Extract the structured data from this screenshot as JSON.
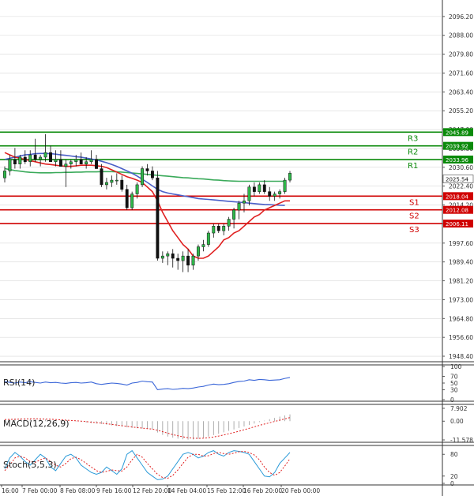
{
  "chart_data": {
    "type": "candlestick",
    "instrument_axis": {
      "ylim": [
        1946,
        2102
      ],
      "ticks": [
        "2096.20",
        "2088.00",
        "2079.80",
        "2071.60",
        "2063.40",
        "2055.20",
        "2047.00",
        "2038.80",
        "2030.60",
        "2022.40",
        "2014.20",
        "2006.00",
        "1997.60",
        "1989.40",
        "1981.20",
        "1973.00",
        "1964.80",
        "1956.60",
        "1948.40"
      ],
      "grid": true
    },
    "x_ticks": [
      "16:00",
      "7 Feb 00:00",
      "8 Feb 08:00",
      "9 Feb 16:00",
      "12 Feb 20:00",
      "14 Feb 04:00",
      "15 Feb 12:00",
      "16 Feb 20:00",
      "20 Feb 00:00"
    ],
    "last_price": "2025.54",
    "levels": [
      {
        "name": "R3",
        "value": 2039.92,
        "label": "2039.92",
        "color": "#0a8a0a"
      },
      {
        "name": "R2",
        "value": 2033.96,
        "label": "2033.96",
        "color": "#0a8a0a"
      },
      {
        "name": "R1",
        "value": 2045.89,
        "label": "2045.89",
        "color": "#0a8a0a"
      },
      {
        "name": "S1",
        "value": 2018.04,
        "label": "2018.04",
        "color": "#d00000"
      },
      {
        "name": "S2",
        "value": 2012.08,
        "label": "2012.08",
        "color": "#d00000"
      },
      {
        "name": "S3",
        "value": 2006.11,
        "label": "2006.11",
        "color": "#d00000"
      }
    ],
    "candles": [
      [
        2026,
        2031,
        2024,
        2029
      ],
      [
        2029,
        2036,
        2027,
        2034
      ],
      [
        2034,
        2039,
        2030,
        2032
      ],
      [
        2032,
        2036,
        2030,
        2035
      ],
      [
        2035,
        2038,
        2032,
        2033
      ],
      [
        2033,
        2038,
        2031,
        2036
      ],
      [
        2036,
        2043,
        2033,
        2034
      ],
      [
        2034,
        2036,
        2031,
        2035
      ],
      [
        2035,
        2045,
        2033,
        2037
      ],
      [
        2037,
        2040,
        2034,
        2033
      ],
      [
        2033,
        2038,
        2031,
        2034
      ],
      [
        2034,
        2038,
        2032,
        2031
      ],
      [
        2031,
        2034,
        2022,
        2032
      ],
      [
        2032,
        2034,
        2030,
        2033
      ],
      [
        2033,
        2036,
        2031,
        2034
      ],
      [
        2034,
        2037,
        2032,
        2032
      ],
      [
        2032,
        2035,
        2030,
        2033
      ],
      [
        2033,
        2038,
        2032,
        2034
      ],
      [
        2034,
        2036,
        2030,
        2030
      ],
      [
        2030,
        2032,
        2022,
        2023
      ],
      [
        2023,
        2026,
        2021,
        2024
      ],
      [
        2024,
        2027,
        2022,
        2025
      ],
      [
        2025,
        2028,
        2023,
        2025
      ],
      [
        2025,
        2027,
        2020,
        2021
      ],
      [
        2021,
        2023,
        2012,
        2013
      ],
      [
        2013,
        2020,
        2012,
        2019
      ],
      [
        2019,
        2024,
        2017,
        2023
      ],
      [
        2023,
        2031,
        2022,
        2030
      ],
      [
        2030,
        2032,
        2027,
        2029
      ],
      [
        2029,
        2031,
        2025,
        2026
      ],
      [
        2026,
        2029,
        1990,
        1991
      ],
      [
        1991,
        1994,
        1989,
        1992
      ],
      [
        1992,
        1994,
        1988,
        1993
      ],
      [
        1993,
        1995,
        1987,
        1991
      ],
      [
        1991,
        1993,
        1986,
        1990
      ],
      [
        1990,
        1994,
        1985,
        1992
      ],
      [
        1992,
        1995,
        1985,
        1988
      ],
      [
        1988,
        1993,
        1986,
        1992
      ],
      [
        1992,
        1997,
        1990,
        1996
      ],
      [
        1996,
        1999,
        1994,
        1997
      ],
      [
        1997,
        2003,
        1996,
        2002
      ],
      [
        2002,
        2006,
        2000,
        2005
      ],
      [
        2005,
        2006,
        2002,
        2003
      ],
      [
        2003,
        2006,
        2001,
        2005
      ],
      [
        2005,
        2009,
        2003,
        2008
      ],
      [
        2008,
        2013,
        2004,
        2012
      ],
      [
        2012,
        2016,
        2008,
        2015
      ],
      [
        2015,
        2019,
        2011,
        2016
      ],
      [
        2016,
        2023,
        2014,
        2022
      ],
      [
        2022,
        2024,
        2018,
        2020
      ],
      [
        2020,
        2024,
        2019,
        2023
      ],
      [
        2023,
        2025,
        2019,
        2020
      ],
      [
        2020,
        2022,
        2016,
        2018
      ],
      [
        2018,
        2020,
        2016,
        2019
      ],
      [
        2019,
        2021,
        2017,
        2020
      ],
      [
        2020,
        2026,
        2019,
        2025
      ],
      [
        2025,
        2029,
        2024,
        2028
      ]
    ],
    "ma_red": [
      2037,
      2036,
      2035,
      2034.5,
      2034,
      2033.5,
      2033,
      2032.5,
      2032,
      2031.8,
      2031.5,
      2031.2,
      2031,
      2031,
      2031.2,
      2031.5,
      2031.5,
      2031.5,
      2031.3,
      2031,
      2030.5,
      2029.5,
      2028.5,
      2027.5,
      2026.5,
      2025.8,
      2025,
      2024,
      2022,
      2020,
      2016,
      2011,
      2007,
      2003,
      2000,
      1997,
      1995,
      1992,
      1991,
      1991,
      1992,
      1994,
      1996,
      1999,
      2000,
      2002,
      2003,
      2005,
      2007,
      2009,
      2010,
      2012,
      2013,
      2014,
      2015,
      2016,
      2016
    ],
    "ma_blue": [
      2034,
      2034.5,
      2035,
      2035.5,
      2036,
      2036.2,
      2036.5,
      2036.6,
      2036.6,
      2036.5,
      2036.3,
      2036,
      2035.8,
      2035.5,
      2035.2,
      2035,
      2034.6,
      2034.2,
      2033.8,
      2033.2,
      2032.6,
      2031.8,
      2031,
      2030,
      2029,
      2028,
      2026.8,
      2025.4,
      2024,
      2022.5,
      2021,
      2020,
      2019.4,
      2019,
      2018.6,
      2018.2,
      2017.8,
      2017.4,
      2017,
      2016.8,
      2016.6,
      2016.4,
      2016.2,
      2016,
      2015.8,
      2015.6,
      2015.4,
      2015.2,
      2015,
      2014.8,
      2014.6,
      2014.4,
      2014.3,
      2014.2,
      2014.1,
      2014
    ],
    "ma_green": [
      2030,
      2029.6,
      2029.2,
      2028.9,
      2028.6,
      2028.4,
      2028.3,
      2028.2,
      2028.2,
      2028.2,
      2028.3,
      2028.3,
      2028.4,
      2028.4,
      2028.5,
      2028.5,
      2028.6,
      2028.6,
      2028.6,
      2028.7,
      2028.7,
      2028.7,
      2028.6,
      2028.5,
      2028.3,
      2028.1,
      2027.9,
      2027.7,
      2027.5,
      2027.3,
      2027.1,
      2026.9,
      2026.7,
      2026.5,
      2026.3,
      2026.1,
      2026,
      2025.8,
      2025.6,
      2025.5,
      2025.3,
      2025.1,
      2025,
      2024.8,
      2024.7,
      2024.6,
      2024.5,
      2024.5,
      2024.5,
      2024.5,
      2024.5,
      2024.5,
      2024.5,
      2024.5,
      2024.5,
      2024.5
    ],
    "rsi": {
      "label": "RSI(14)",
      "ticks": [
        "100",
        "70",
        "50",
        "30",
        "0"
      ],
      "values": [
        55,
        52,
        50,
        53,
        51,
        54,
        52,
        50,
        53,
        51,
        52,
        50,
        49,
        51,
        52,
        50,
        51,
        53,
        48,
        46,
        48,
        50,
        49,
        47,
        44,
        50,
        52,
        56,
        54,
        53,
        30,
        32,
        33,
        31,
        32,
        34,
        33,
        35,
        38,
        40,
        44,
        47,
        45,
        46,
        48,
        52,
        55,
        56,
        60,
        58,
        61,
        60,
        58,
        59,
        60,
        64,
        67
      ]
    },
    "macd": {
      "label": "MACD(12,26,9)",
      "ticks": [
        "7.902",
        "0.00",
        "-11.578"
      ],
      "values": [
        1,
        1.2,
        1.4,
        1.5,
        1.6,
        1.6,
        1.5,
        1.3,
        1.1,
        0.8,
        0.6,
        0.4,
        0.2,
        0,
        -0.2,
        -0.5,
        -0.8,
        -1.2,
        -1.5,
        -1.8,
        -2.2,
        -2.6,
        -3,
        -3.3,
        -3.8,
        -4.2,
        -4.4,
        -4.5,
        -4.6,
        -4.8,
        -7,
        -8.5,
        -9.5,
        -10.2,
        -10.8,
        -11.2,
        -11.4,
        -11.3,
        -10.9,
        -10.2,
        -9.5,
        -8.6,
        -7.8,
        -6.9,
        -6,
        -5.1,
        -4.2,
        -3.3,
        -2.4,
        -1.5,
        -0.6,
        0.3,
        1.2,
        2,
        2.8,
        3.5,
        4.2
      ],
      "signal": [
        1,
        1.1,
        1.2,
        1.3,
        1.4,
        1.45,
        1.45,
        1.4,
        1.3,
        1.2,
        1,
        0.8,
        0.6,
        0.4,
        0.2,
        0,
        -0.3,
        -0.6,
        -0.9,
        -1.2,
        -1.6,
        -2,
        -2.4,
        -2.8,
        -3.2,
        -3.6,
        -4,
        -4.3,
        -4.6,
        -4.9,
        -5.6,
        -6.5,
        -7.4,
        -8.3,
        -9,
        -9.7,
        -10.2,
        -10.5,
        -10.6,
        -10.5,
        -10.2,
        -9.8,
        -9.2,
        -8.5,
        -7.8,
        -7,
        -6.2,
        -5.3,
        -4.4,
        -3.5,
        -2.6,
        -1.8,
        -1,
        -0.2,
        0.6,
        1.4,
        2.2
      ]
    },
    "stoch": {
      "label": "Stoch(5,5,3)",
      "ticks": [
        "80",
        "20",
        "0"
      ],
      "k": [
        40,
        70,
        85,
        75,
        60,
        50,
        65,
        80,
        70,
        45,
        35,
        55,
        75,
        80,
        70,
        50,
        40,
        30,
        25,
        30,
        45,
        35,
        25,
        40,
        80,
        90,
        70,
        50,
        30,
        20,
        10,
        12,
        20,
        40,
        60,
        80,
        85,
        80,
        70,
        75,
        85,
        90,
        80,
        75,
        85,
        90,
        88,
        85,
        80,
        60,
        40,
        20,
        18,
        30,
        55,
        70,
        85
      ],
      "d": [
        35,
        50,
        70,
        75,
        70,
        60,
        58,
        65,
        70,
        60,
        50,
        45,
        55,
        68,
        72,
        65,
        55,
        45,
        35,
        30,
        33,
        37,
        35,
        34,
        45,
        65,
        80,
        72,
        55,
        40,
        25,
        16,
        14,
        22,
        37,
        55,
        72,
        80,
        80,
        75,
        76,
        82,
        85,
        82,
        80,
        83,
        87,
        88,
        85,
        78,
        65,
        45,
        30,
        22,
        30,
        48,
        68
      ]
    }
  }
}
